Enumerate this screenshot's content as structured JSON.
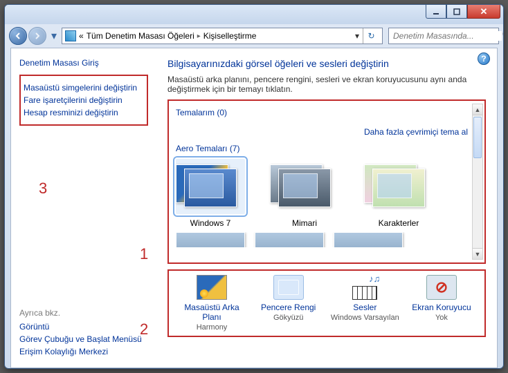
{
  "breadcrumb": {
    "root": "«",
    "parent": "Tüm Denetim Masası Öğeleri",
    "current": "Kişiselleştirme"
  },
  "search_placeholder": "Denetim Masasında...",
  "sidebar": {
    "home": "Denetim Masası Giriş",
    "tasks": [
      "Masaüstü simgelerini değiştirin",
      "Fare işaretçilerini değiştirin",
      "Hesap resminizi değiştirin"
    ],
    "see_also_title": "Ayrıca bkz.",
    "see_also": [
      "Görüntü",
      "Görev Çubuğu ve Başlat Menüsü",
      "Erişim Kolaylığı Merkezi"
    ]
  },
  "annotations": {
    "a1": "1",
    "a2": "2",
    "a3": "3"
  },
  "main": {
    "heading": "Bilgisayarınızdaki görsel öğeleri ve sesleri değiştirin",
    "sub": "Masaüstü arka planını, pencere rengini, sesleri ve ekran koruyucusunu aynı anda değiştirmek için bir temayı tıklatın.",
    "my_themes_label": "Temalarım (0)",
    "more_link": "Daha fazla çevrimiçi tema al",
    "aero_label": "Aero Temaları (7)",
    "themes": [
      {
        "name": "Windows 7"
      },
      {
        "name": "Mimari"
      },
      {
        "name": "Karakterler"
      }
    ],
    "bottom": [
      {
        "label": "Masaüstü Arka Planı",
        "value": "Harmony"
      },
      {
        "label": "Pencere Rengi",
        "value": "Gökyüzü"
      },
      {
        "label": "Sesler",
        "value": "Windows Varsayılan"
      },
      {
        "label": "Ekran Koruyucu",
        "value": "Yok"
      }
    ]
  }
}
